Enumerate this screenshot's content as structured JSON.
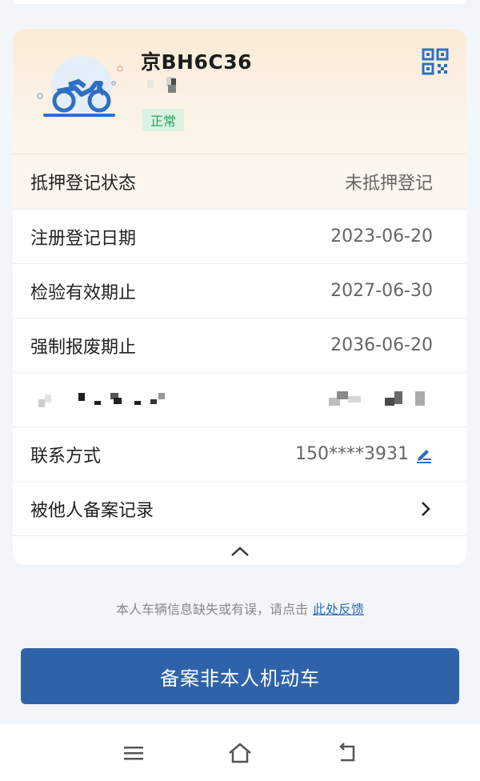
{
  "vehicle": {
    "plate": "京BH6C36",
    "status": "正常",
    "icons": {
      "illustration": "motorcycle-icon",
      "qr": "qr-code-icon"
    }
  },
  "details": {
    "pledge": {
      "label": "抵押登记状态",
      "value": "未抵押登记"
    },
    "registration": {
      "label": "注册登记日期",
      "value": "2023-06-20"
    },
    "inspection": {
      "label": "检验有效期止",
      "value": "2027-06-30"
    },
    "scrap": {
      "label": "强制报废期止",
      "value": "2036-06-20"
    },
    "contact": {
      "label": "联系方式",
      "value": "150****3931",
      "icon": "edit-icon"
    },
    "records": {
      "label": "被他人备案记录",
      "icon": "chevron-right-icon"
    }
  },
  "collapse_icon": "chevron-up-icon",
  "feedback": {
    "text": "本人车辆信息缺失或有误，请点击",
    "link": "此处反馈"
  },
  "primary_button": "备案非本人机动车",
  "navbar": {
    "icons": [
      "menu-icon",
      "home-icon",
      "back-icon"
    ]
  },
  "colors": {
    "accent": "#2f63a9",
    "link": "#2c6fb8",
    "status_bg": "#d9f2e2",
    "status_text": "#2aa05a",
    "header_bg": "#f9ebd6"
  }
}
